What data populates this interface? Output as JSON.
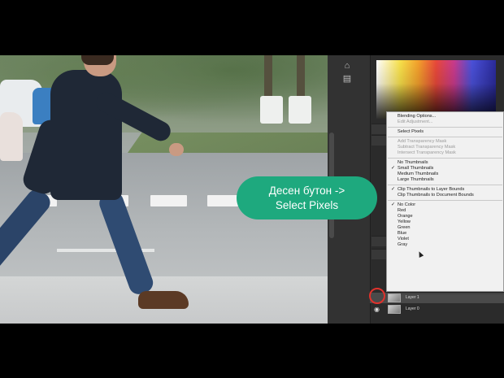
{
  "annotation": {
    "line1": "Десен бутон ->",
    "line2": "Select Pixels",
    "color": "#1ea97e"
  },
  "context_menu": {
    "items": [
      {
        "label": "Blending Options...",
        "disabled": false,
        "checked": false
      },
      {
        "label": "Edit Adjustment...",
        "disabled": true,
        "checked": false
      },
      {
        "sep": true
      },
      {
        "label": "Select Pixels",
        "disabled": false,
        "checked": false
      },
      {
        "sep": true
      },
      {
        "label": "Add Transparency Mask",
        "disabled": true,
        "checked": false
      },
      {
        "label": "Subtract Transparency Mask",
        "disabled": true,
        "checked": false
      },
      {
        "label": "Intersect Transparency Mask",
        "disabled": true,
        "checked": false
      },
      {
        "sep": true
      },
      {
        "label": "No Thumbnails",
        "disabled": false,
        "checked": false
      },
      {
        "label": "Small Thumbnails",
        "disabled": false,
        "checked": true
      },
      {
        "label": "Medium Thumbnails",
        "disabled": false,
        "checked": false
      },
      {
        "label": "Large Thumbnails",
        "disabled": false,
        "checked": false
      },
      {
        "sep": true
      },
      {
        "label": "Clip Thumbnails to Layer Bounds",
        "disabled": false,
        "checked": true
      },
      {
        "label": "Clip Thumbnails to Document Bounds",
        "disabled": false,
        "checked": false
      },
      {
        "sep": true
      },
      {
        "label": "No Color",
        "disabled": false,
        "checked": true
      },
      {
        "label": "Red",
        "disabled": false,
        "checked": false
      },
      {
        "label": "Orange",
        "disabled": false,
        "checked": false
      },
      {
        "label": "Yellow",
        "disabled": false,
        "checked": false
      },
      {
        "label": "Green",
        "disabled": false,
        "checked": false
      },
      {
        "label": "Blue",
        "disabled": false,
        "checked": false
      },
      {
        "label": "Violet",
        "disabled": false,
        "checked": false
      },
      {
        "label": "Gray",
        "disabled": false,
        "checked": false
      }
    ]
  },
  "layers": {
    "rows": [
      {
        "name": "Layer 1",
        "selected": true
      },
      {
        "name": "Layer 0",
        "selected": false
      }
    ],
    "highlight_color": "#e0322c"
  },
  "icons": {
    "eye": "eye-icon",
    "check": "check-icon"
  }
}
